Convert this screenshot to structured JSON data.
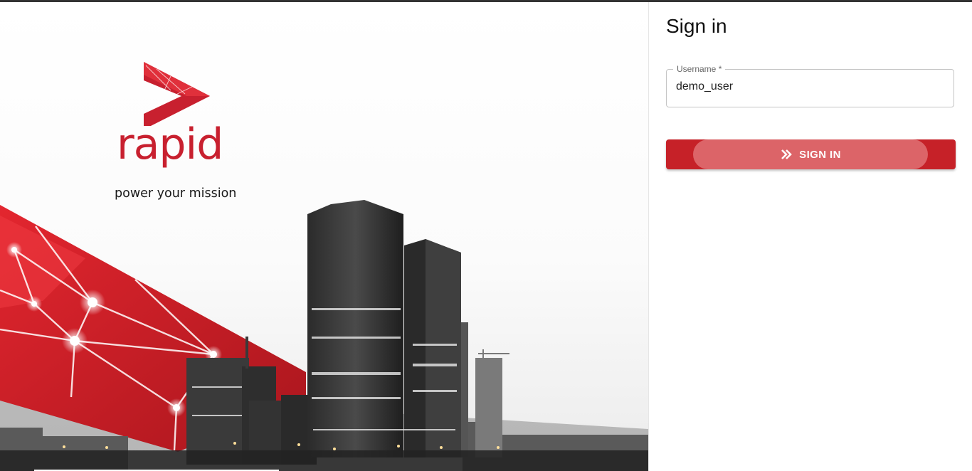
{
  "brand": {
    "name": "rapid",
    "tagline": "power your mission",
    "accent_color": "#c8202f"
  },
  "signin": {
    "title": "Sign in",
    "username_label": "Username *",
    "username_value": "demo_user",
    "button_label": "SIGN IN",
    "button_icon": "double-chevron-right-icon",
    "button_color": "#c62128"
  }
}
